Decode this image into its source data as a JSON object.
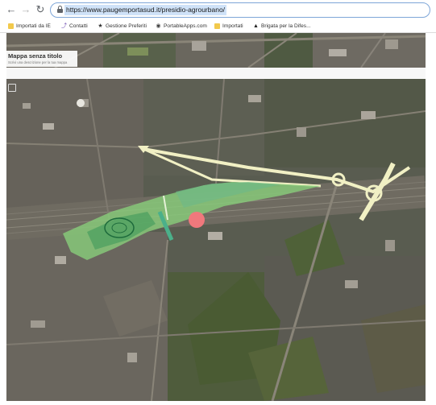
{
  "browser": {
    "back_icon": "arrow-left-icon",
    "forward_icon": "arrow-right-icon",
    "reload_icon": "reload-icon",
    "lock_icon": "lock-icon",
    "url": "https://www.paugemportasud.it/presidio-agrourbano/",
    "url_highlight_color": "#cfe2f8"
  },
  "bookmarks": [
    {
      "label": "Importati da IE",
      "icon": "folder-icon"
    },
    {
      "label": "Contatti",
      "icon": "link-icon"
    },
    {
      "label": "Gestione Preferiti",
      "icon": "star-icon"
    },
    {
      "label": "PortableApps.com",
      "icon": "globe-icon"
    },
    {
      "label": "Importati",
      "icon": "folder-icon"
    },
    {
      "label": "Brigata per la Difes...",
      "icon": "paw-icon"
    }
  ],
  "map": {
    "title": "Mappa senza titolo",
    "description": "Scrivi una descrizione per la tua mappa",
    "colors": {
      "route": "#f1f0c4",
      "area_fill": "#87cc7a",
      "area_dark": "#3f9a5a",
      "marker": "#f0787c",
      "urban": "#6f6a62",
      "fields": "#4d5a3a"
    }
  }
}
